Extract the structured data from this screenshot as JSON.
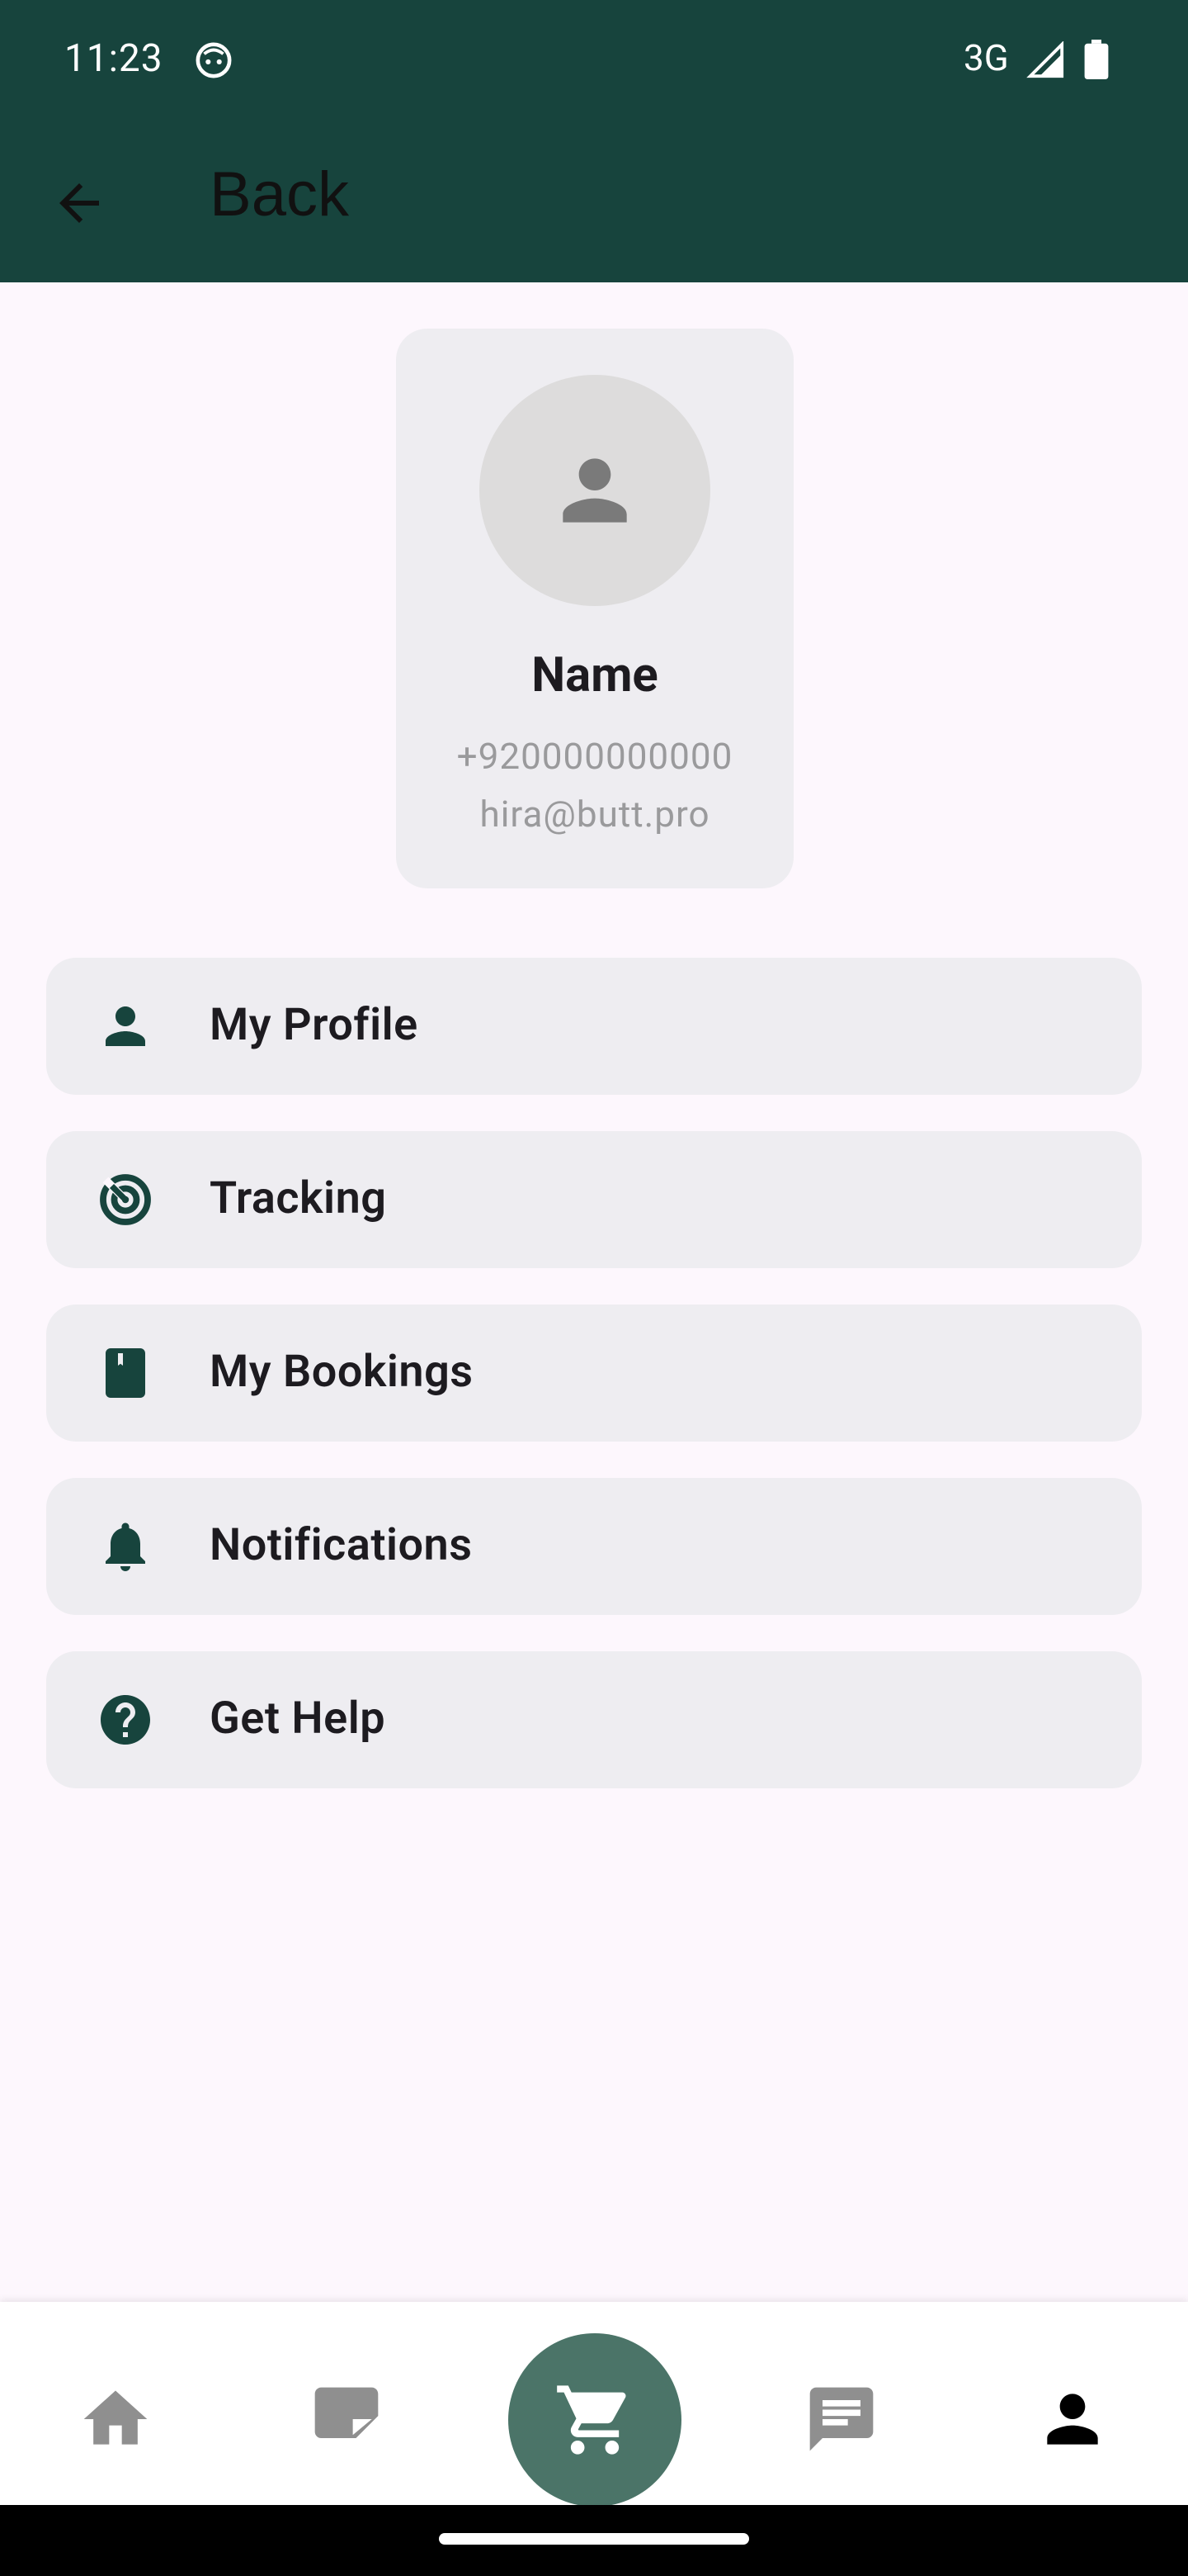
{
  "status_bar": {
    "time": "11:23",
    "network": "3G",
    "icons": [
      "face-icon",
      "signal-icon",
      "battery-icon"
    ]
  },
  "app_bar": {
    "back_label": "Back",
    "icon": "arrow-back-icon"
  },
  "profile": {
    "name": "Name",
    "phone": "+920000000000",
    "email": "hira@butt.pro",
    "avatar_icon": "person-icon"
  },
  "menu": {
    "items": [
      {
        "label": "My Profile",
        "icon": "person-icon"
      },
      {
        "label": "Tracking",
        "icon": "radar-icon"
      },
      {
        "label": "My Bookings",
        "icon": "bookmark-icon"
      },
      {
        "label": "Notifications",
        "icon": "bell-icon"
      },
      {
        "label": "Get Help",
        "icon": "help-icon"
      }
    ]
  },
  "bottom_nav": {
    "items": [
      "home-icon",
      "note-icon",
      "cart-icon",
      "chat-icon",
      "person-icon"
    ],
    "active": "person-icon"
  },
  "colors": {
    "primary_dark": "#17443d",
    "background": "#fdf7fd",
    "card": "#eeedf1",
    "fab": "#4b7468",
    "inactive_icon": "#8f8f8f"
  }
}
